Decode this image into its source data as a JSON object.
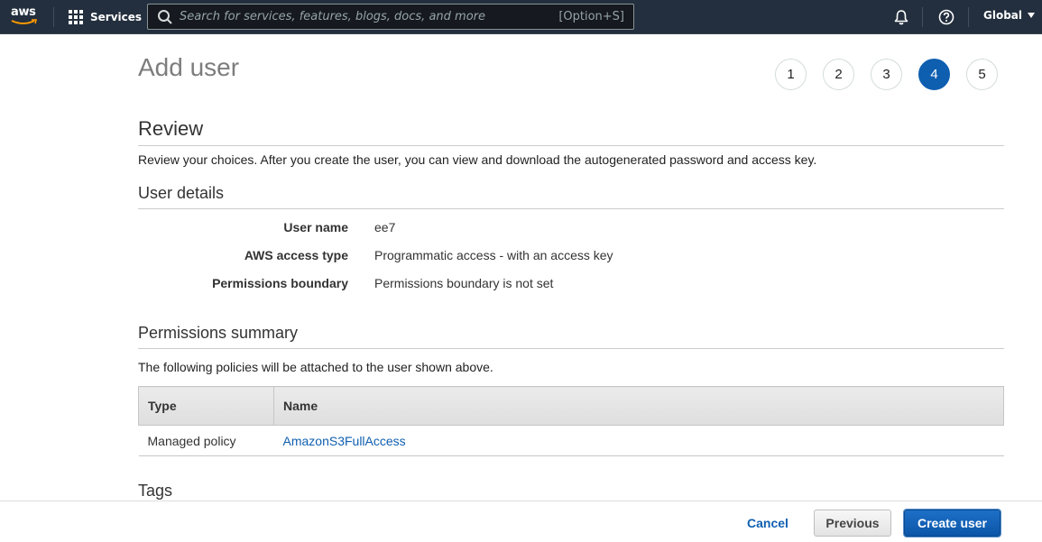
{
  "topnav": {
    "logo_text": "aws",
    "services_label": "Services",
    "search_placeholder": "Search for services, features, blogs, docs, and more",
    "search_value": "",
    "search_shortcut": "[Option+S]",
    "region_label": "Global",
    "icons": {
      "logo": "aws-logo-icon",
      "services": "grid-icon",
      "search": "search-icon",
      "notifications": "bell-icon",
      "help": "help-circle-icon",
      "region_caret": "caret-down-icon"
    }
  },
  "page": {
    "title": "Add user",
    "steps": [
      {
        "label": "1",
        "active": false
      },
      {
        "label": "2",
        "active": false
      },
      {
        "label": "3",
        "active": false
      },
      {
        "label": "4",
        "active": true
      },
      {
        "label": "5",
        "active": false
      }
    ]
  },
  "review": {
    "heading": "Review",
    "description": "Review your choices. After you create the user, you can view and download the autogenerated password and access key."
  },
  "user_details": {
    "heading": "User details",
    "rows": [
      {
        "label": "User name",
        "value": "ee7"
      },
      {
        "label": "AWS access type",
        "value": "Programmatic access - with an access key"
      },
      {
        "label": "Permissions boundary",
        "value": "Permissions boundary is not set"
      }
    ]
  },
  "permissions_summary": {
    "heading": "Permissions summary",
    "description": "The following policies will be attached to the user shown above.",
    "columns": [
      "Type",
      "Name"
    ],
    "rows": [
      {
        "type": "Managed policy",
        "name": "AmazonS3FullAccess"
      }
    ]
  },
  "tags": {
    "heading": "Tags"
  },
  "footer": {
    "cancel_label": "Cancel",
    "previous_label": "Previous",
    "create_label": "Create user"
  },
  "colors": {
    "nav_bg": "#232f3e",
    "accent_blue": "#0f5fb0",
    "link_blue": "#0f5fb0"
  }
}
